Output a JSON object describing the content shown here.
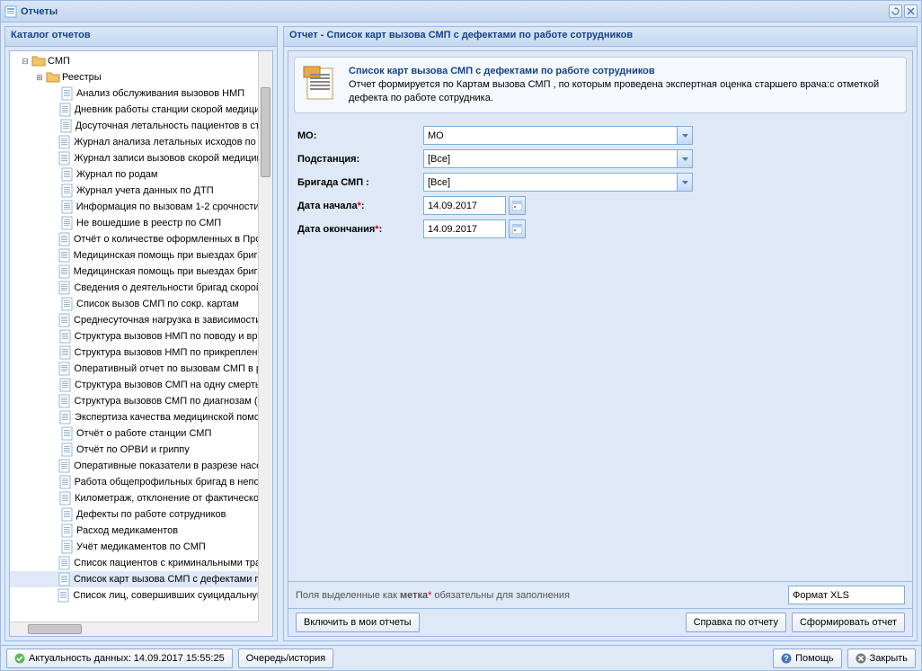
{
  "title": "Отчеты",
  "catalog_header": "Каталог отчетов",
  "tree": {
    "root": "СМП",
    "registries": "Реестры",
    "items": [
      "Анализ обслуживания вызовов НМП",
      "Дневник работы станции скорой медицинс",
      "Досуточная летальность пациентов в ста",
      "Журнал анализа летальных исходов по СС",
      "Журнал записи вызовов скорой медицинск",
      "Журнал по родам",
      "Журнал учета данных по ДТП",
      "Информация по вызовам 1-2 срочности",
      "Не вошедшие в реестр по СМП",
      "Отчёт о количестве оформленных в ПроМе",
      "Медицинская помощь при выездах бригад с",
      "Медицинская помощь при выездах бригад с",
      "Сведения о деятельности бригад скорой м",
      "Список вызов СМП по сокр. картам",
      "Среднесуточная нагрузка в зависимости от",
      "Структура вызовов НМП по поводу и врем",
      "Структура вызовов НМП по прикреплению",
      "Оперативный отчет по вызовам СМП в раз",
      "Структура вызовов СМП на одну смерть в",
      "Структура вызовов СМП по диагнозам (в р",
      "Экспертиза качества медицинской помощ",
      "Отчёт о работе станции СМП",
      "Отчёт по ОРВИ и гриппу",
      "Оперативные показатели в разрезе населе",
      "Работа общепрофильных бригад в неполн",
      "Километраж, отклонение от фактического",
      "Дефекты по работе сотрудников",
      "Расход медикаментов",
      "Учёт медикаментов по СМП",
      "Список пациентов с криминальными травм",
      "Список карт вызова СМП с дефектами по р",
      "Список лиц, совершивших суицидальную пс"
    ],
    "selected_index": 30
  },
  "right": {
    "header": "Отчет - Список карт вызова СМП с дефектами по работе сотрудников",
    "desc_title": "Список карт вызова СМП с дефектами по работе сотрудников",
    "desc_text": "Отчет формируется по Картам вызова СМП , по которым проведена экспертная оценка старшего врача:с отметкой дефекта по работе сотрудника.",
    "form": {
      "mo_label": "МО:",
      "mo_value": "МО",
      "substation_label": "Подстанция:",
      "substation_value": "[Все]",
      "brigade_label": "Бригада СМП :",
      "brigade_value": "[Все]",
      "date_start_label": "Дата начала",
      "date_start_value": "14.09.2017",
      "date_end_label": "Дата окончания",
      "date_end_value": "14.09.2017"
    },
    "hint_prefix": "Поля выделенные как ",
    "hint_bold": "метка",
    "hint_suffix": " обязательны для заполнения",
    "format_value": "Формат XLS",
    "btn_include": "Включить в мои отчеты",
    "btn_help_report": "Справка по отчету",
    "btn_generate": "Сформировать отчет"
  },
  "status": {
    "actuality": "Актуальность данных: 14.09.2017 15:55:25",
    "queue": "Очередь/история",
    "help": "Помощь",
    "close": "Закрыть"
  }
}
